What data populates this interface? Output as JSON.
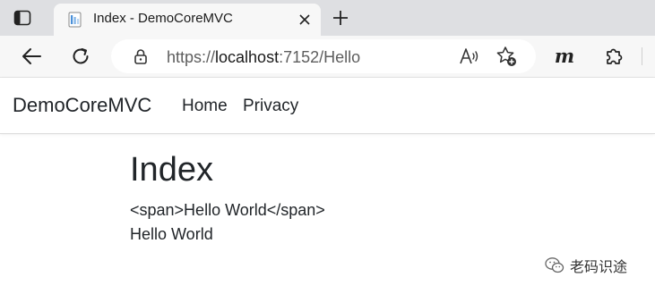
{
  "browser": {
    "tab": {
      "title": "Index - DemoCoreMVC"
    },
    "address": {
      "protocol": "https://",
      "host": "localhost",
      "rest": ":7152/Hello"
    },
    "extension_m_label": "m",
    "icons": [
      "tab-actions-icon",
      "favicon-icon",
      "close-icon",
      "plus-icon",
      "back-arrow-icon",
      "refresh-icon",
      "lock-icon",
      "read-aloud-icon",
      "add-favorite-icon",
      "puzzle-icon"
    ]
  },
  "site": {
    "brand": "DemoCoreMVC",
    "nav": [
      {
        "label": "Home"
      },
      {
        "label": "Privacy"
      }
    ]
  },
  "main": {
    "title": "Index",
    "lines": [
      "<span>Hello World</span>",
      "Hello World"
    ]
  },
  "watermark": {
    "text": "老码识途"
  }
}
